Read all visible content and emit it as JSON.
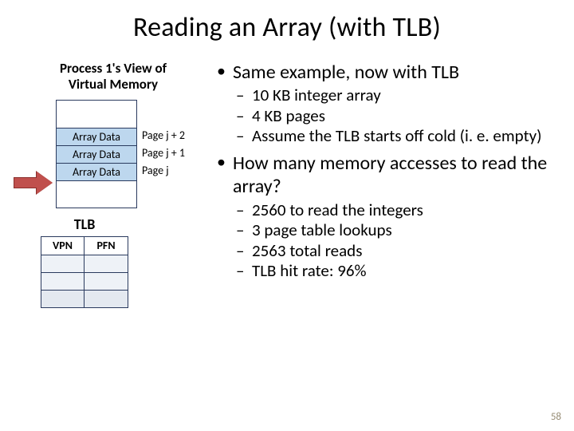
{
  "title": "Reading an Array (with TLB)",
  "left": {
    "caption_l1": "Process 1's View of",
    "caption_l2": "Virtual Memory",
    "mem_rows": [
      "",
      "Array Data",
      "Array Data",
      "Array Data",
      "",
      ""
    ],
    "mem_labels": [
      "Page j + 2",
      "Page j + 1",
      "Page j"
    ]
  },
  "tlb": {
    "title": "TLB",
    "headers": [
      "VPN",
      "PFN"
    ]
  },
  "bullets": {
    "b1": "Same example, now with TLB",
    "b1_sub": [
      "10 KB integer array",
      "4 KB pages",
      "Assume the TLB starts off cold (i. e. empty)"
    ],
    "b2": "How many memory accesses to read the array?",
    "b2_sub": [
      "2560 to read the integers",
      "3 page table lookups",
      "2563 total reads",
      "TLB hit rate: 96%"
    ]
  },
  "page_number": "58"
}
